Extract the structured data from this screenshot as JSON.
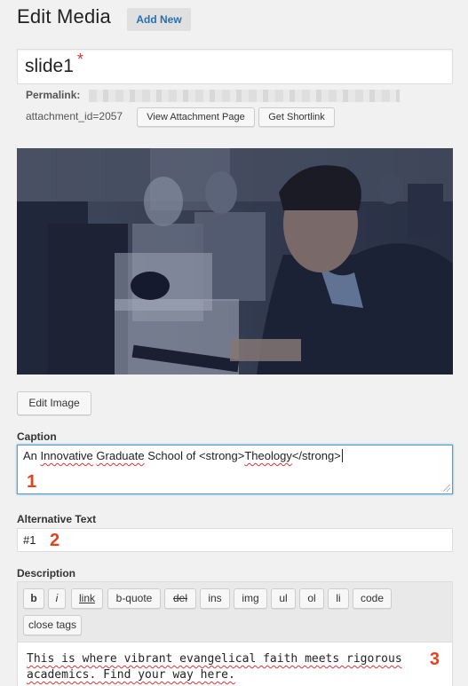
{
  "header": {
    "title": "Edit Media",
    "add_new_label": "Add New"
  },
  "post_title": {
    "value": "slide1",
    "required_mark": "*"
  },
  "permalink": {
    "label": "Permalink:"
  },
  "attachment": {
    "id_text": "attachment_id=2057",
    "view_button": "View Attachment Page",
    "shortlink_button": "Get Shortlink"
  },
  "image": {
    "edit_button": "Edit Image"
  },
  "caption": {
    "label": "Caption",
    "value_prefix": "An ",
    "value_word1": "Innovative",
    "value_space1": " ",
    "value_word2": "Graduate",
    "value_mid": " School of <strong>",
    "value_word3": "Theology",
    "value_suffix": "</strong>",
    "marker": "1"
  },
  "alt_text": {
    "label": "Alternative Text",
    "value": "#1",
    "marker": "2"
  },
  "description": {
    "label": "Description",
    "toolbar": [
      "b",
      "i",
      "link",
      "b-quote",
      "del",
      "ins",
      "img",
      "ul",
      "ol",
      "li",
      "code",
      "close tags"
    ],
    "line1": "This is where vibrant evangelical faith meets rigorous",
    "line2": "academics. Find your way here.",
    "marker": "3"
  },
  "colors": {
    "accent_link": "#2271b1",
    "marker": "#e8401c",
    "focus_border": "#5b9dd9"
  },
  "icons": [
    "resize-handle-icon"
  ]
}
